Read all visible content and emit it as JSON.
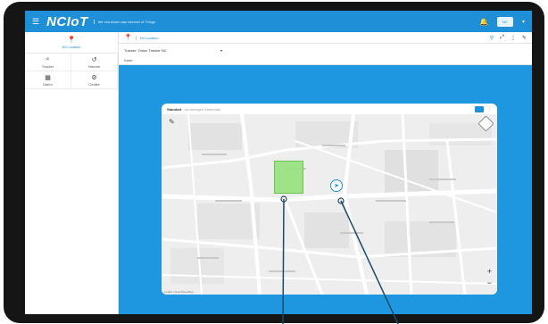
{
  "app": {
    "logo": "NCIoT",
    "tagline": "Wir vernetzen das Internet of Things"
  },
  "topbar": {
    "menu_icon": "hamburger-icon",
    "bell_icon": "bell-icon",
    "user_chip": "NC"
  },
  "sidebar": {
    "header_label": "NCLocation",
    "items": [
      {
        "label": "Tracker",
        "icon": "search-icon"
      },
      {
        "label": "Historie",
        "icon": "history-icon"
      },
      {
        "label": "Daten",
        "icon": "data-icon"
      },
      {
        "label": "Geräte",
        "icon": "devices-icon"
      }
    ]
  },
  "content": {
    "header_title": "NCLocation",
    "tracker_select": "Tracker: Onion Tracker NC",
    "karte_label": "Karte"
  },
  "map_card": {
    "title": "Standort",
    "subtitle": "vor wenigen Sekunden",
    "attribution": "Leaflet | OpenStreetMap"
  },
  "colors": {
    "brand": "#1f8fd8",
    "fence": "#97e27d"
  }
}
